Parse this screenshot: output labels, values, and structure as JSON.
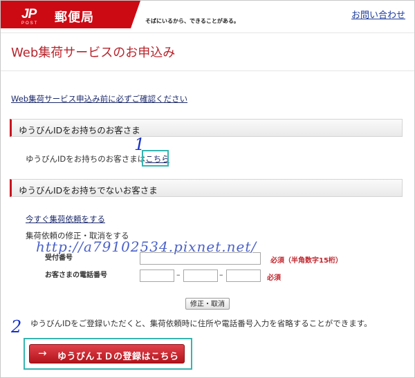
{
  "header": {
    "logo_text": "JP",
    "logo_sub": "POST",
    "brand": "郵便局",
    "tagline": "そばにいるから、できることがある。",
    "contact_link": "お問い合わせ"
  },
  "page_title": "Web集荷サービスのお申込み",
  "confirm_link": "Web集荷サービス申込み前に必ずご確認ください",
  "section_with_id": {
    "heading": "ゆうびんIDをお持ちのお客さま",
    "text_prefix": "ゆうびんIDをお持ちのお客さまは",
    "link": "こちら"
  },
  "section_without_id": {
    "heading": "ゆうびんIDをお持ちでないお客さま",
    "request_link": "今すぐ集荷依頼をする",
    "modify_label": "集荷依頼の修正・取消をする",
    "receipt_label": "受付番号",
    "receipt_required": "必須（半角数字15桁）",
    "phone_label": "お客さまの電話番号",
    "phone_required": "必須",
    "phone_separator": "–",
    "modify_button": "修正・取消",
    "info_text": "ゆうびんIDをご登録いただくと、集荷依頼時に住所や電話番号入力を省略することができます。",
    "register_button": "ゆうびんＩＤの登録はこちら",
    "register_arrow": "→"
  },
  "annotations": {
    "step1": "1",
    "step2": "2",
    "watermark": "http://a79102534.pixnet.net/",
    "highlight_color": "#35b4b0",
    "annotation_color": "#1530c8"
  },
  "colors": {
    "brand_red": "#cc0a14",
    "title_red": "#b8242c",
    "link_blue": "#1d2b6b"
  }
}
